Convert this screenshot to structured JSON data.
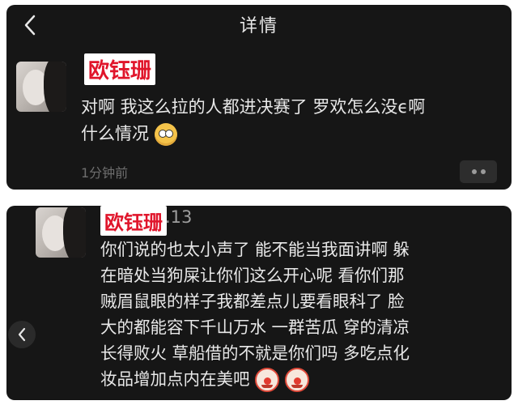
{
  "header": {
    "back_icon": "chevron-left-icon",
    "title": "详情"
  },
  "comment1": {
    "name": "欧钰珊",
    "lines": [
      "对啊 我这么拉的人都进决赛了 罗欢怎么没ϵ啊",
      "什么情况"
    ],
    "emoji": "flushed-face-emoji",
    "time": "1分钟前",
    "more_icon": "more-dots-icon"
  },
  "comment2": {
    "name": "欧钰珊",
    "uid_suffix": ".13",
    "lines": [
      "你们说的也太小声了 能不能当我面讲啊 躲",
      "在暗处当狗屎让你们这么开心呢 看你们那",
      "贼眉鼠眼的样子我都差点儿要看眼科了 脸",
      "大的都能容下千山万水 一群苦瓜 穿的清凉",
      "长得败火 草船借的不就是你们吗 多吃点化",
      "妆品增加点内在美吧"
    ],
    "emoji": "clown-face-emoji",
    "nav_icon": "chevron-left-icon"
  },
  "colors": {
    "background": "#161616",
    "text": "#e8e8e8",
    "name_red": "#e0152b",
    "meta_gray": "#6e6e6e"
  }
}
